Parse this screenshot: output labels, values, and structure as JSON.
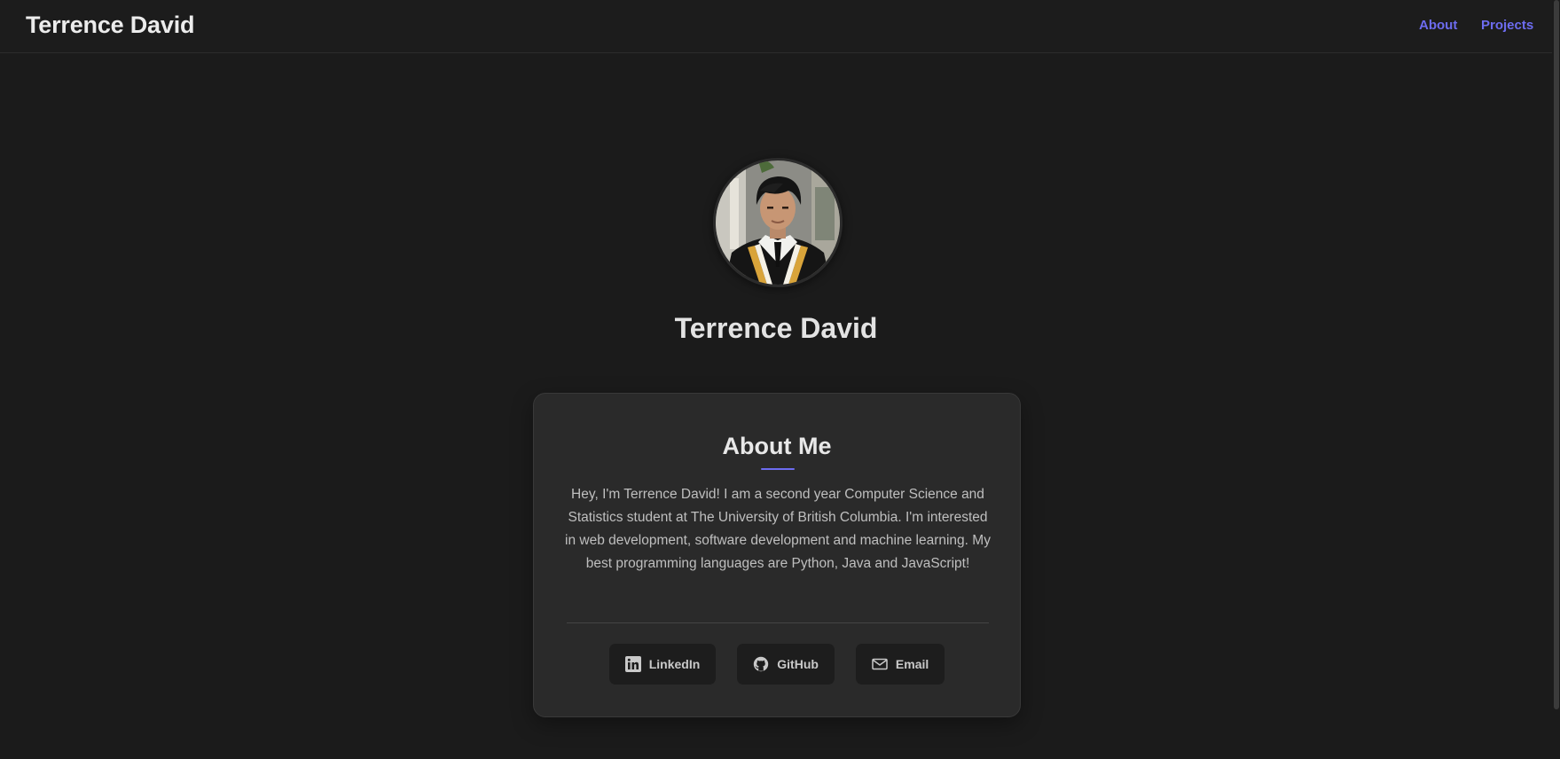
{
  "header": {
    "brand": "Terrence David",
    "nav": [
      {
        "label": "About"
      },
      {
        "label": "Projects"
      }
    ],
    "link_color": "#6d6cf0"
  },
  "profile": {
    "name": "Terrence David"
  },
  "about": {
    "title": "About Me",
    "text": "Hey, I'm Terrence David! I am a second year Computer Science and Statistics student at The University of British Columbia. I'm interested in web development, software development and machine learning. My best programming languages are Python, Java and JavaScript!"
  },
  "social": [
    {
      "label": "LinkedIn",
      "icon": "linkedin-icon"
    },
    {
      "label": "GitHub",
      "icon": "github-icon"
    },
    {
      "label": "Email",
      "icon": "mail-icon"
    }
  ],
  "colors": {
    "background": "#1b1b1b",
    "card": "#2a2a2a",
    "accent": "#6d6cf0"
  }
}
